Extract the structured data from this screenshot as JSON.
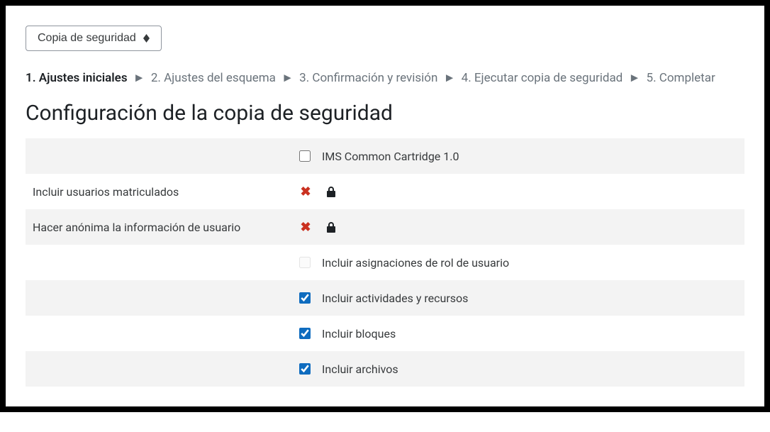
{
  "dropdown": {
    "label": "Copia de seguridad"
  },
  "breadcrumb": {
    "steps": [
      "1. Ajustes iniciales",
      "2. Ajustes del esquema",
      "3. Confirmación y revisión",
      "4. Ejecutar copia de seguridad",
      "5. Completar"
    ]
  },
  "heading": "Configuración de la copia de seguridad",
  "rows": {
    "ims": {
      "label": "IMS Common Cartridge 1.0"
    },
    "enrolled": {
      "label": "Incluir usuarios matriculados"
    },
    "anon": {
      "label": "Hacer anónima la información de usuario"
    },
    "role": {
      "label": "Incluir asignaciones de rol de usuario"
    },
    "activities": {
      "label": "Incluir actividades y recursos"
    },
    "blocks": {
      "label": "Incluir bloques"
    },
    "files": {
      "label": "Incluir archivos"
    }
  }
}
